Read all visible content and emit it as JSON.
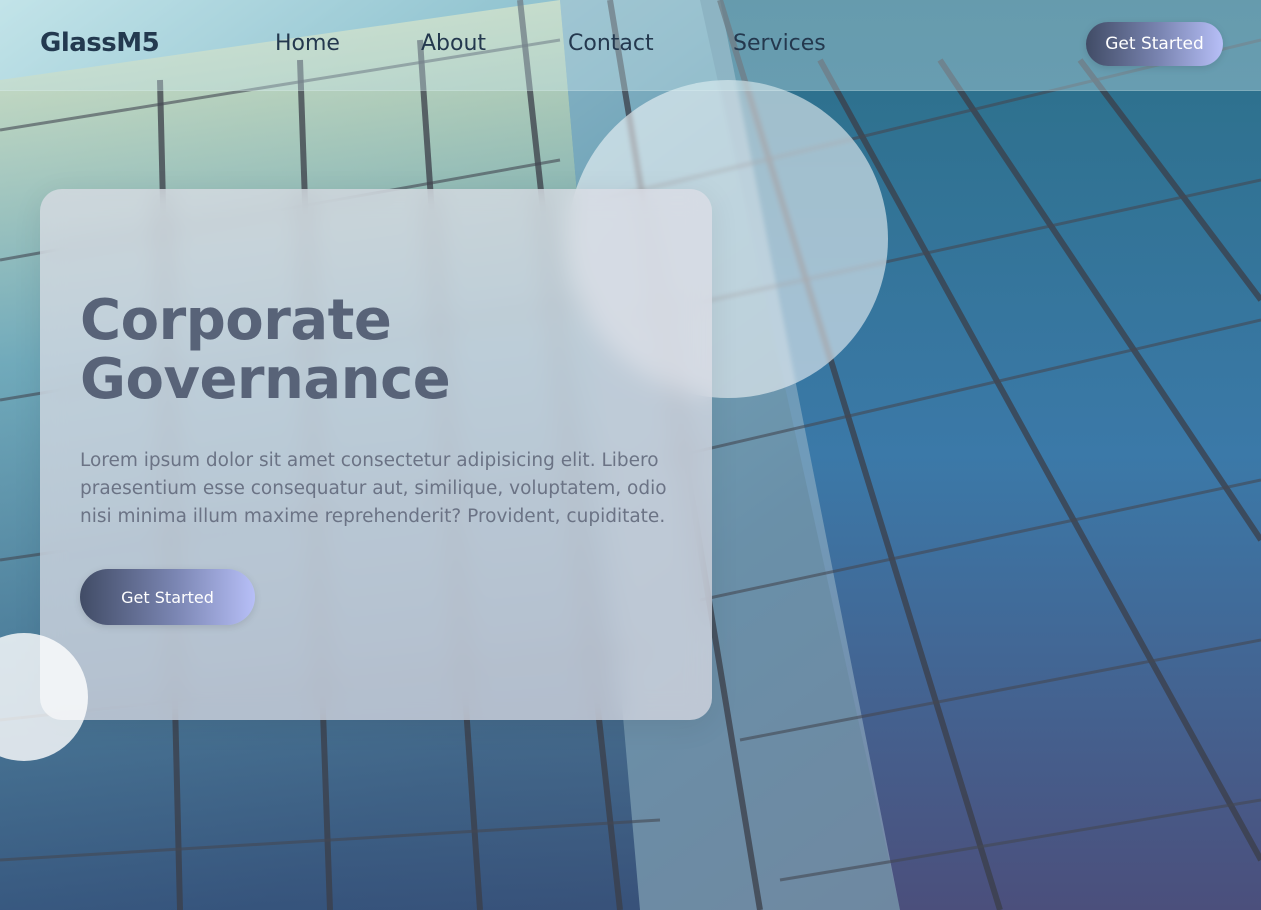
{
  "nav": {
    "brand": "GlassM5",
    "links": [
      {
        "label": "Home"
      },
      {
        "label": "About"
      },
      {
        "label": "Contact"
      },
      {
        "label": "Services"
      }
    ],
    "cta_label": "Get Started"
  },
  "hero": {
    "title_line1": "Corporate",
    "title_line2": "Governance",
    "body": "Lorem ipsum dolor sit amet consectetur adipisicing elit. Libero praesentium esse consequatur aut, similique, voluptatem, odio nisi minima illum maxime reprehenderit? Provident, cupiditate.",
    "cta_label": "Get Started"
  },
  "colors": {
    "brand_text": "#23394f",
    "title_text": "#586378",
    "button_gradient_start": "#414c66",
    "button_gradient_end": "#b7bff7"
  }
}
